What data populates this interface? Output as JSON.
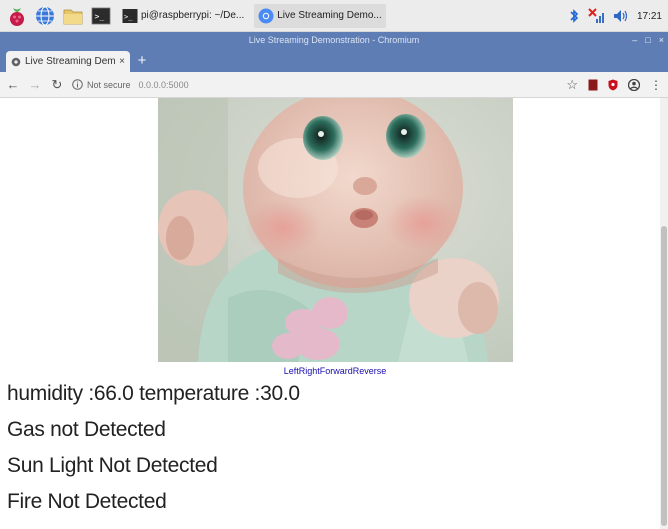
{
  "taskbar": {
    "tasks": [
      {
        "label": "pi@raspberrypi: ~/De...",
        "icon": "terminal-icon"
      },
      {
        "label": "Live Streaming Demo...",
        "icon": "chromium-icon"
      }
    ],
    "clock": "17:21"
  },
  "window": {
    "title": "Live Streaming Demonstration - Chromium"
  },
  "tab": {
    "label": "Live Streaming Demonst",
    "close": "×",
    "new_tab": "+"
  },
  "address_bar": {
    "security": "Not secure",
    "url": "0.0.0.0:5000"
  },
  "controls": {
    "links": [
      "Left",
      "Right",
      "Forward",
      "Reverse"
    ]
  },
  "sensor": {
    "humidity_temperature": "humidity :66.0 temperature :30.0",
    "gas": "Gas not Detected",
    "sunlight": "Sun Light Not Detected",
    "fire": "Fire Not Detected"
  },
  "colors": {
    "chrome_frame": "#5e7db4",
    "link": "#1a0dab"
  }
}
